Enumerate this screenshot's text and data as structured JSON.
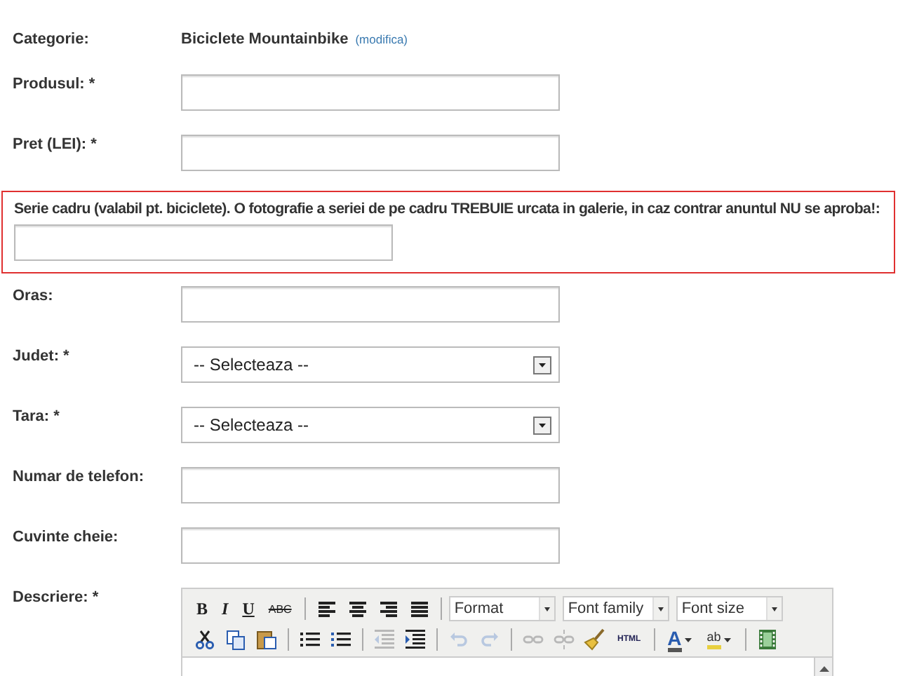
{
  "category": {
    "label": "Categorie:",
    "value": "Biciclete Mountainbike",
    "link": "(modifica)"
  },
  "fields": [
    {
      "kind": "text",
      "label": "Produsul: *",
      "highlighted": false
    },
    {
      "kind": "text",
      "label": "Pret (LEI): *",
      "highlighted": false
    },
    {
      "kind": "text",
      "label": "Serie cadru (valabil pt. biciclete). O fotografie a seriei de pe cadru TREBUIE urcata in galerie, in caz contrar anuntul NU se aproba!:",
      "highlighted": true
    },
    {
      "kind": "text",
      "label": "Oras:",
      "highlighted": false
    },
    {
      "kind": "select",
      "label": "Judet: *",
      "value": "-- Selecteaza --",
      "highlighted": false
    },
    {
      "kind": "select",
      "label": "Tara: *",
      "value": "-- Selecteaza --",
      "highlighted": false
    },
    {
      "kind": "text",
      "label": "Numar de telefon:",
      "highlighted": false
    },
    {
      "kind": "text",
      "label": "Cuvinte cheie:",
      "highlighted": false
    },
    {
      "kind": "editor",
      "label": "Descriere: *",
      "highlighted": false
    }
  ],
  "editor": {
    "toolbar_rows": [
      [
        {
          "kind": "bold",
          "label": "B"
        },
        {
          "kind": "italic",
          "label": "I"
        },
        {
          "kind": "underline",
          "label": "U"
        },
        {
          "kind": "strike",
          "label": "ABC"
        },
        {
          "kind": "separator"
        },
        {
          "kind": "align-left"
        },
        {
          "kind": "align-center"
        },
        {
          "kind": "align-right"
        },
        {
          "kind": "justify"
        },
        {
          "kind": "separator"
        },
        {
          "kind": "dropdown",
          "label": "Format"
        },
        {
          "kind": "dropdown",
          "label": "Font family"
        },
        {
          "kind": "dropdown",
          "label": "Font size"
        }
      ],
      [
        {
          "kind": "cut",
          "disabled": false
        },
        {
          "kind": "copy",
          "disabled": false
        },
        {
          "kind": "paste",
          "disabled": false
        },
        {
          "kind": "separator"
        },
        {
          "kind": "bullet-list",
          "disabled": false
        },
        {
          "kind": "number-list",
          "disabled": false
        },
        {
          "kind": "separator"
        },
        {
          "kind": "outdent",
          "disabled": true
        },
        {
          "kind": "indent",
          "disabled": false
        },
        {
          "kind": "separator"
        },
        {
          "kind": "undo",
          "disabled": true
        },
        {
          "kind": "redo",
          "disabled": true
        },
        {
          "kind": "separator"
        },
        {
          "kind": "link",
          "disabled": true
        },
        {
          "kind": "unlink",
          "disabled": true
        },
        {
          "kind": "cleanup",
          "disabled": false
        },
        {
          "kind": "html",
          "label": "HTML",
          "disabled": false
        },
        {
          "kind": "separator"
        },
        {
          "kind": "font-color",
          "label": "A",
          "disabled": false
        },
        {
          "kind": "highlight",
          "label": "ab",
          "disabled": false
        },
        {
          "kind": "separator"
        },
        {
          "kind": "media",
          "disabled": false
        }
      ]
    ]
  }
}
